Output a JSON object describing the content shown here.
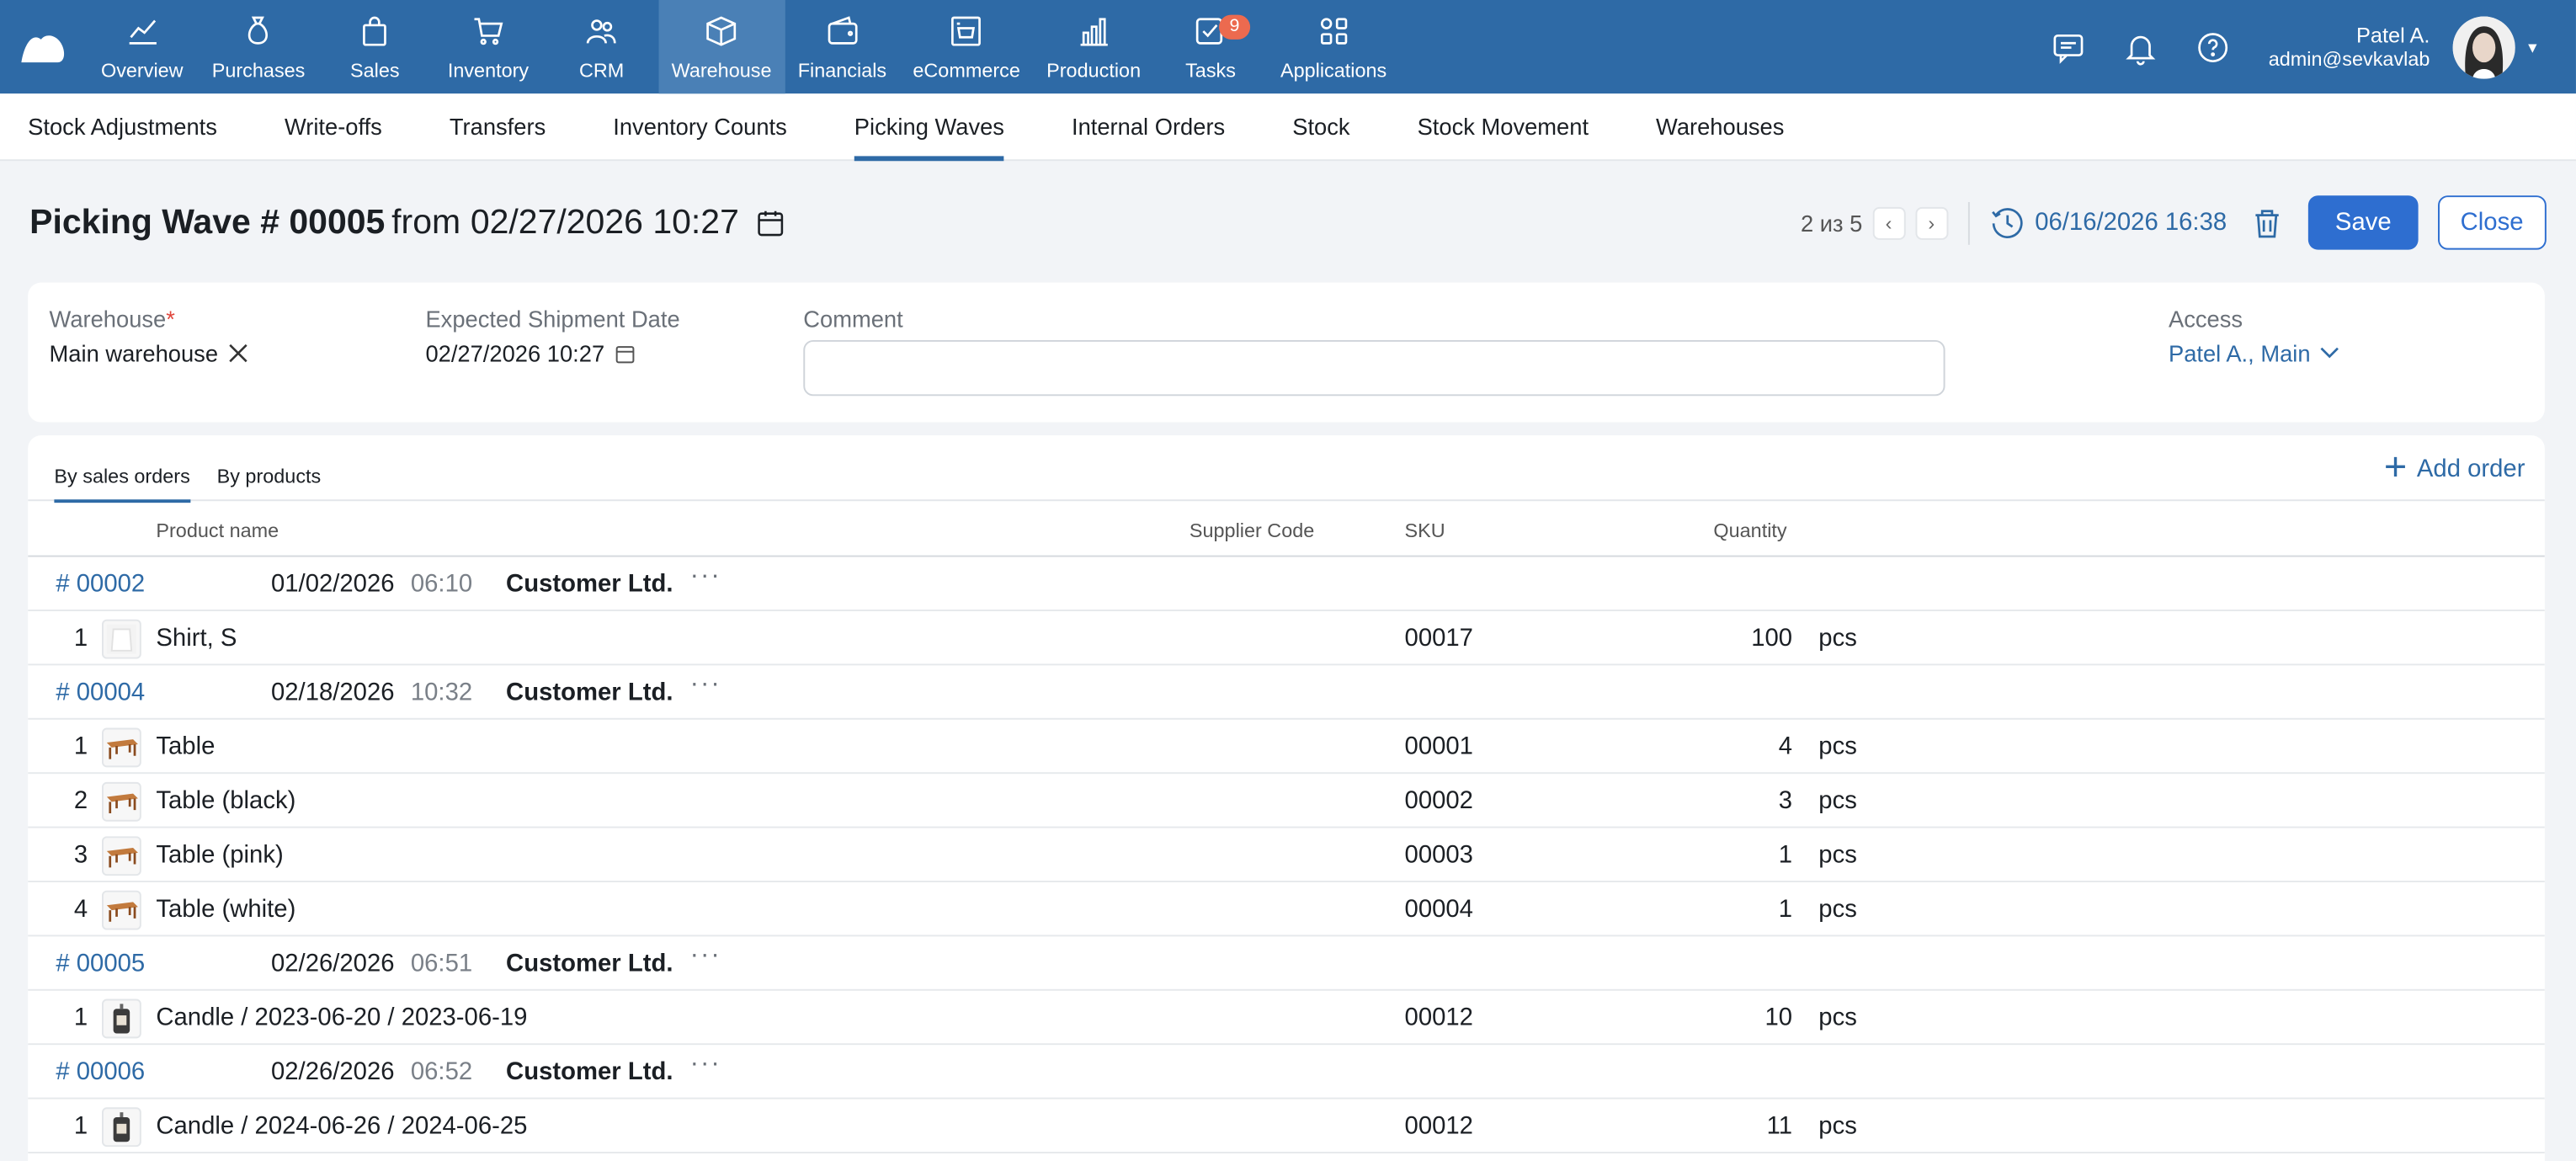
{
  "nav": {
    "items": [
      {
        "label": "Overview",
        "icon": "chart-line-icon"
      },
      {
        "label": "Purchases",
        "icon": "money-bag-icon"
      },
      {
        "label": "Sales",
        "icon": "shopping-bag-icon"
      },
      {
        "label": "Inventory",
        "icon": "cart-icon"
      },
      {
        "label": "CRM",
        "icon": "people-icon"
      },
      {
        "label": "Warehouse",
        "icon": "box-icon"
      },
      {
        "label": "Financials",
        "icon": "wallet-icon"
      },
      {
        "label": "eCommerce",
        "icon": "shop-icon"
      },
      {
        "label": "Production",
        "icon": "factory-icon"
      },
      {
        "label": "Tasks",
        "icon": "tasks-icon",
        "badge": "9"
      },
      {
        "label": "Applications",
        "icon": "grid-icon"
      }
    ],
    "active": "Warehouse",
    "user": {
      "name": "Patel A.",
      "email": "admin@sevkavlab"
    }
  },
  "subnav": {
    "tabs": [
      "Stock Adjustments",
      "Write-offs",
      "Transfers",
      "Inventory Counts",
      "Picking Waves",
      "Internal Orders",
      "Stock",
      "Stock Movement",
      "Warehouses"
    ],
    "active": "Picking Waves"
  },
  "header": {
    "title": "Picking Wave # 00005",
    "from": "from",
    "date": "02/27/2026 10:27",
    "pager": "2 из 5",
    "timestamp": "06/16/2026 16:38",
    "save": "Save",
    "close": "Close"
  },
  "form": {
    "warehouse_label": "Warehouse",
    "warehouse_req": "*",
    "warehouse_value": "Main warehouse",
    "shipment_label": "Expected Shipment Date",
    "shipment_value": "02/27/2026 10:27",
    "comment_label": "Comment",
    "comment_value": "",
    "access_label": "Access",
    "access_value": "Patel A., Main"
  },
  "table": {
    "tabs": [
      "By sales orders",
      "By products"
    ],
    "add_order": "Add order",
    "columns": {
      "product": "Product name",
      "supplier": "Supplier Code",
      "sku": "SKU",
      "qty": "Quantity"
    },
    "rows": [
      {
        "kind": "order",
        "number": "# 00002",
        "date": "01/02/2026",
        "time": "06:10",
        "customer": "Customer Ltd."
      },
      {
        "kind": "item",
        "idx": "1",
        "thumb": "shirt",
        "name": "Shirt, S",
        "sku": "00017",
        "qty": "100",
        "unit": "pcs"
      },
      {
        "kind": "order",
        "number": "# 00004",
        "date": "02/18/2026",
        "time": "10:32",
        "customer": "Customer Ltd."
      },
      {
        "kind": "item",
        "idx": "1",
        "thumb": "table",
        "name": "Table",
        "sku": "00001",
        "qty": "4",
        "unit": "pcs"
      },
      {
        "kind": "item",
        "idx": "2",
        "thumb": "table",
        "name": "Table (black)",
        "sku": "00002",
        "qty": "3",
        "unit": "pcs"
      },
      {
        "kind": "item",
        "idx": "3",
        "thumb": "table",
        "name": "Table (pink)",
        "sku": "00003",
        "qty": "1",
        "unit": "pcs"
      },
      {
        "kind": "item",
        "idx": "4",
        "thumb": "table",
        "name": "Table (white)",
        "sku": "00004",
        "qty": "1",
        "unit": "pcs"
      },
      {
        "kind": "order",
        "number": "# 00005",
        "date": "02/26/2026",
        "time": "06:51",
        "customer": "Customer Ltd."
      },
      {
        "kind": "item",
        "idx": "1",
        "thumb": "candle",
        "name": "Candle / 2023-06-20 / 2023-06-19",
        "sku": "00012",
        "qty": "10",
        "unit": "pcs"
      },
      {
        "kind": "order",
        "number": "# 00006",
        "date": "02/26/2026",
        "time": "06:52",
        "customer": "Customer Ltd."
      },
      {
        "kind": "item",
        "idx": "1",
        "thumb": "candle",
        "name": "Candle / 2024-06-26 / 2024-06-25",
        "sku": "00012",
        "qty": "11",
        "unit": "pcs"
      }
    ]
  },
  "colors": {
    "brand": "#2e6aa6",
    "accent": "#2e6ed0",
    "badge": "#ec6a4f"
  }
}
